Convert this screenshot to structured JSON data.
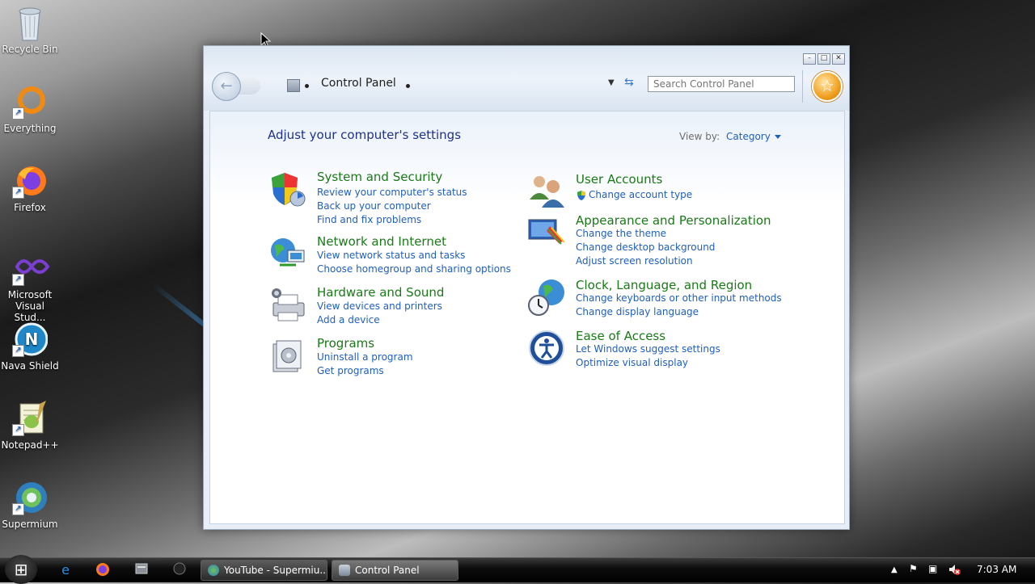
{
  "desktop": {
    "icons": [
      {
        "label": "Recycle Bin",
        "icon": "recycle-bin-icon"
      },
      {
        "label": "Everything",
        "icon": "everything-icon"
      },
      {
        "label": "Firefox",
        "icon": "firefox-icon"
      },
      {
        "label": "Microsoft Visual Stud...",
        "icon": "visual-studio-icon"
      },
      {
        "label": "Nava Shield",
        "icon": "nava-shield-icon"
      },
      {
        "label": "Notepad++",
        "icon": "notepad-plus-plus-icon"
      },
      {
        "label": "Supermium",
        "icon": "supermium-icon"
      }
    ]
  },
  "window": {
    "title_controls": {
      "minimize": "-",
      "maximize": "□",
      "close": "✕"
    },
    "breadcrumb": "Control Panel",
    "search_placeholder": "Search Control Panel",
    "heading": "Adjust your computer's settings",
    "view_by_label": "View by:",
    "view_by_value": "Category",
    "categories_left": [
      {
        "title": "System and Security",
        "links": [
          "Review your computer's status",
          "Back up your computer",
          "Find and fix problems"
        ],
        "icon": "shield-icon"
      },
      {
        "title": "Network and Internet",
        "links": [
          "View network status and tasks",
          "Choose homegroup and sharing options"
        ],
        "icon": "network-globe-icon"
      },
      {
        "title": "Hardware and Sound",
        "links": [
          "View devices and printers",
          "Add a device"
        ],
        "icon": "printer-icon"
      },
      {
        "title": "Programs",
        "links": [
          "Uninstall a program",
          "Get programs"
        ],
        "icon": "programs-icon"
      }
    ],
    "categories_right": [
      {
        "title": "User Accounts",
        "links": [
          "Change account type"
        ],
        "icon": "users-icon"
      },
      {
        "title": "Appearance and Personalization",
        "links": [
          "Change the theme",
          "Change desktop background",
          "Adjust screen resolution"
        ],
        "icon": "monitor-paint-icon"
      },
      {
        "title": "Clock, Language, and Region",
        "links": [
          "Change keyboards or other input methods",
          "Change display language"
        ],
        "icon": "clock-globe-icon"
      },
      {
        "title": "Ease of Access",
        "links": [
          "Let Windows suggest settings",
          "Optimize visual display"
        ],
        "icon": "accessibility-icon"
      }
    ]
  },
  "taskbar": {
    "buttons": [
      {
        "label": "YouTube - Supermiu...",
        "icon": "supermium-icon"
      },
      {
        "label": "Control Panel",
        "icon": "control-panel-icon"
      }
    ],
    "clock": "7:03 AM"
  },
  "colors": {
    "link": "#1f5fbd",
    "category_title": "#197a17",
    "heading": "#1e3287"
  }
}
